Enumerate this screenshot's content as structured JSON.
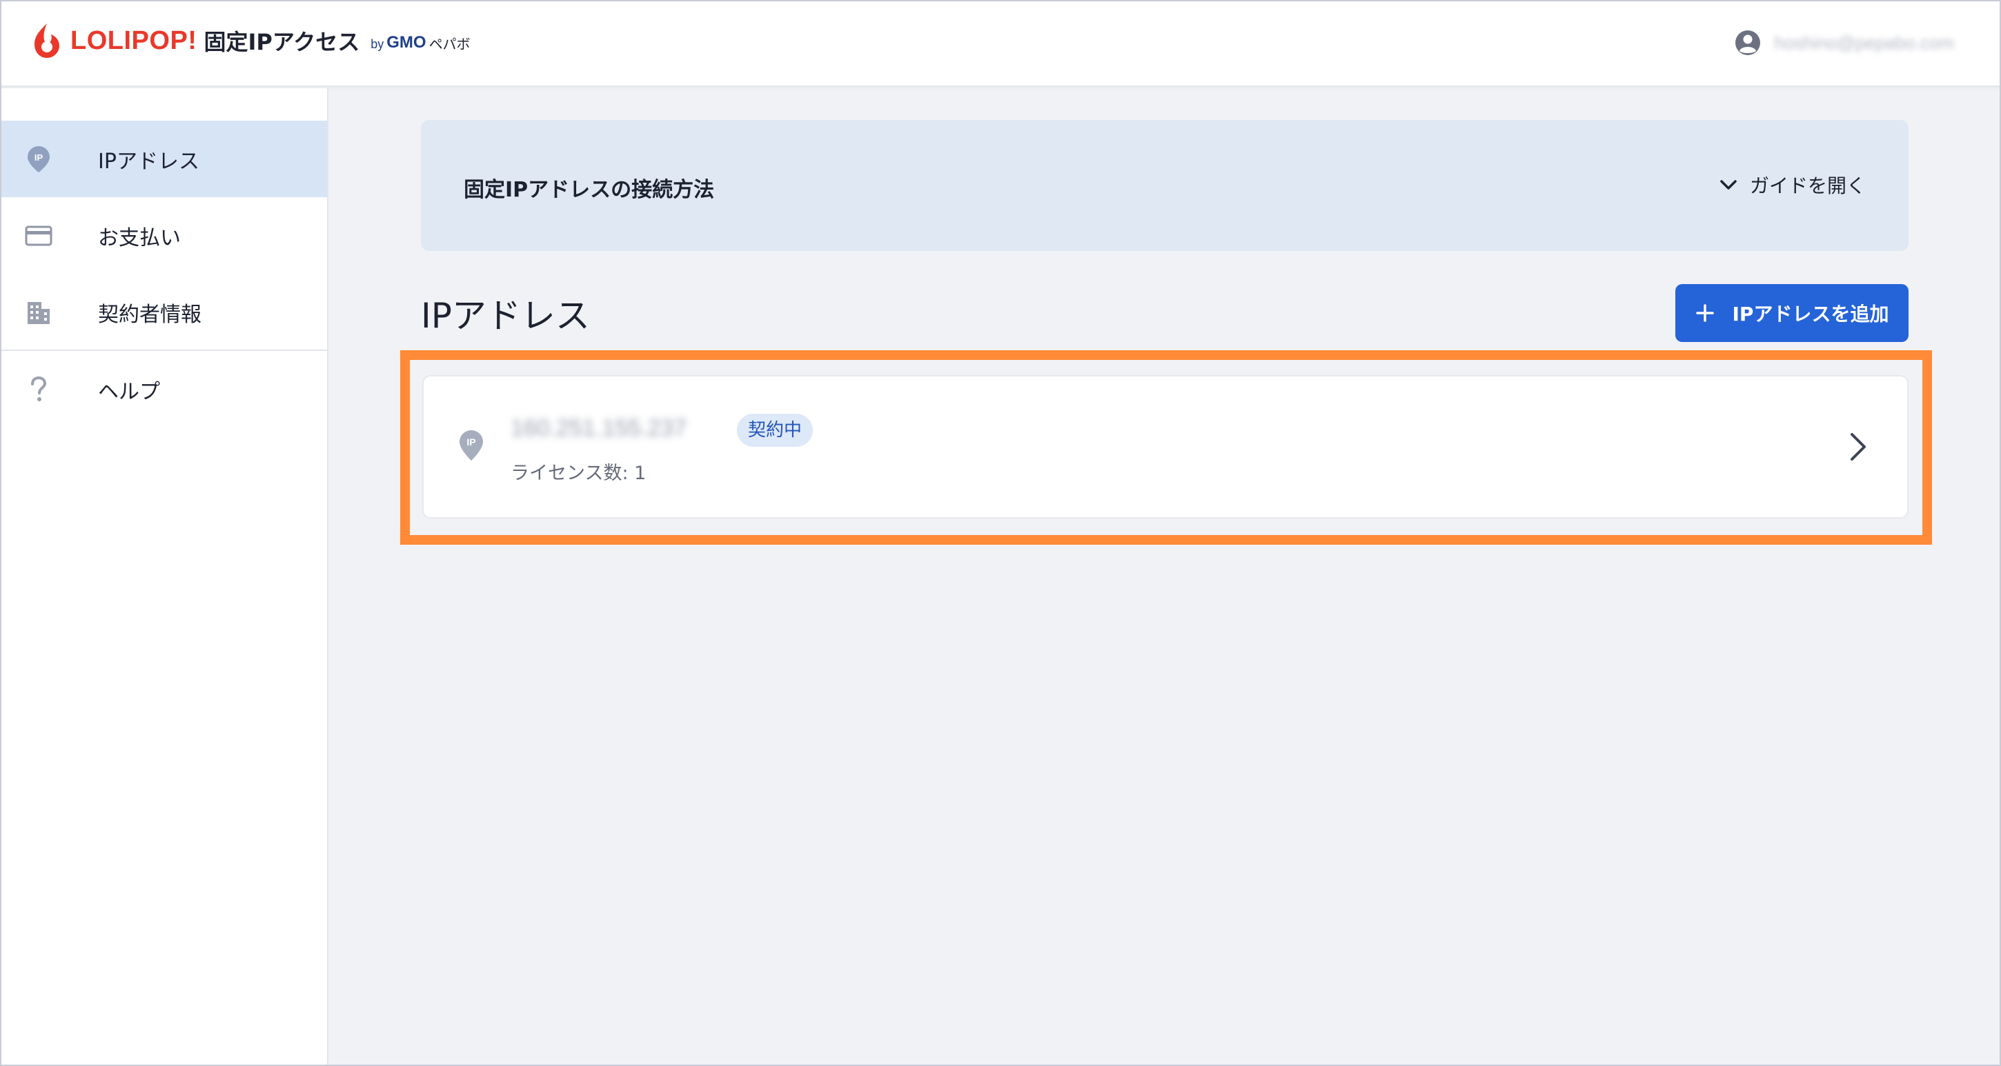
{
  "header": {
    "logo_text": "LOLIPOP!",
    "product_name": "固定IPアクセス",
    "logo_by": "by",
    "logo_gmo": "GMO",
    "logo_pepabo": "ペパボ",
    "account_email": "hoshino@pepabo.com"
  },
  "sidebar": {
    "items": [
      {
        "label": "IPアドレス",
        "icon": "ip-pin-icon",
        "active": true
      },
      {
        "label": "お支払い",
        "icon": "credit-card-icon",
        "active": false
      },
      {
        "label": "契約者情報",
        "icon": "building-icon",
        "active": false
      },
      {
        "label": "ヘルプ",
        "icon": "help-icon",
        "active": false
      }
    ]
  },
  "guide": {
    "title": "固定IPアドレスの接続方法",
    "toggle_label": "ガイドを開く"
  },
  "main": {
    "section_title": "IPアドレス",
    "add_button_label": "IPアドレスを追加",
    "ip_list": [
      {
        "address": "160.251.155.237",
        "status": "契約中",
        "license": "ライセンス数: 1"
      }
    ]
  },
  "colors": {
    "primary": "#2563d8",
    "brand_red": "#e9382a",
    "highlight": "#ff8a38",
    "active_nav": "#d6e4f5"
  }
}
